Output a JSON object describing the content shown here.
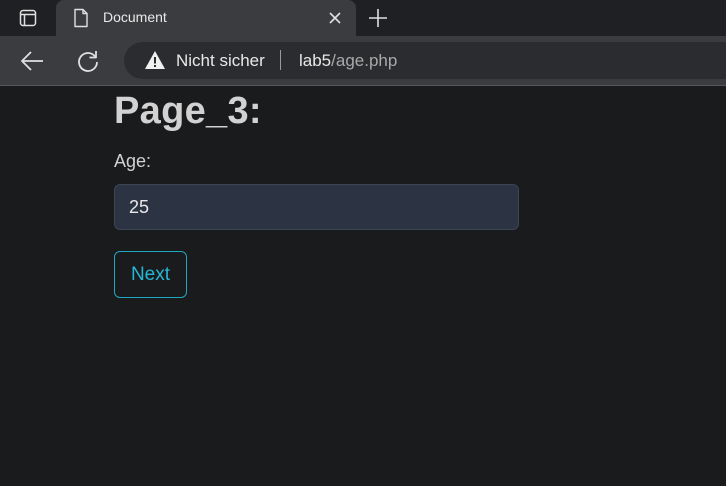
{
  "browser": {
    "tab": {
      "title": "Document"
    },
    "address_bar": {
      "security_label": "Nicht sicher",
      "host": "lab5",
      "path": "/age.php"
    }
  },
  "page": {
    "title": "Page_3:",
    "age_label": "Age:",
    "age_value": "25",
    "next_button": "Next"
  },
  "colors": {
    "page_background": "#1a1b1d",
    "input_background": "#2c3444",
    "accent": "#25b7d6"
  }
}
